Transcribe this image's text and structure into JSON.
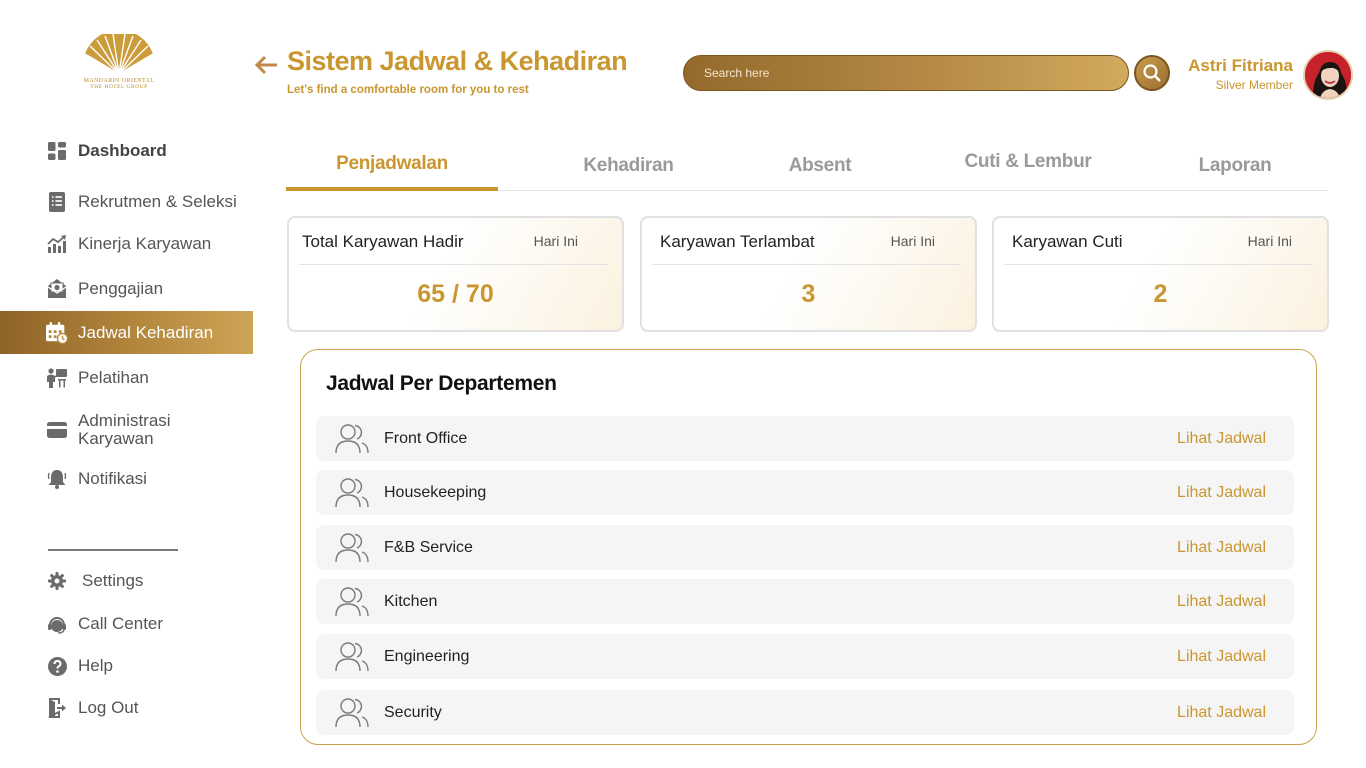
{
  "brand": {
    "name": "MANDARIN ORIENTAL",
    "tagline": "THE HOTEL GROUP",
    "accent": "#c9962f"
  },
  "sidebar": {
    "items": [
      {
        "label": "Dashboard",
        "icon": "dashboard-grid-icon"
      },
      {
        "label": "Rekrutmen & Seleksi",
        "icon": "document-list-icon"
      },
      {
        "label": "Kinerja Karyawan",
        "icon": "chart-trend-icon"
      },
      {
        "label": "Penggajian",
        "icon": "payroll-icon"
      },
      {
        "label": "Jadwal Kehadiran",
        "icon": "calendar-clock-icon",
        "active": true
      },
      {
        "label": "Pelatihan",
        "icon": "training-icon"
      },
      {
        "label": "Administrasi Karyawan",
        "icon": "card-icon"
      },
      {
        "label": "Notifikasi",
        "icon": "bell-icon"
      }
    ],
    "bottom_items": [
      {
        "label": "Settings",
        "icon": "gear-icon"
      },
      {
        "label": "Call Center",
        "icon": "headset-icon"
      },
      {
        "label": "Help",
        "icon": "help-icon"
      },
      {
        "label": "Log Out",
        "icon": "logout-icon"
      }
    ]
  },
  "header": {
    "title": "Sistem Jadwal & Kehadiran",
    "subtitle": "Let's find a comfortable room for you to rest",
    "search_placeholder": "Search here",
    "user_name": "Astri Fitriana",
    "user_role": "Silver Member"
  },
  "tabs": [
    {
      "label": "Penjadwalan",
      "active": true
    },
    {
      "label": "Kehadiran"
    },
    {
      "label": "Absent"
    },
    {
      "label": "Cuti & Lembur"
    },
    {
      "label": "Laporan"
    }
  ],
  "stats": [
    {
      "title": "Total Karyawan Hadir",
      "period": "Hari Ini",
      "value": "65 / 70"
    },
    {
      "title": "Karyawan Terlambat",
      "period": "Hari Ini",
      "value": "3"
    },
    {
      "title": "Karyawan Cuti",
      "period": "Hari Ini",
      "value": "2"
    }
  ],
  "departments": {
    "title": "Jadwal Per Departemen",
    "link_label": "Lihat Jadwal",
    "rows": [
      {
        "name": "Front Office"
      },
      {
        "name": "Housekeeping"
      },
      {
        "name": "F&B Service"
      },
      {
        "name": "Kitchen"
      },
      {
        "name": "Engineering"
      },
      {
        "name": "Security"
      }
    ]
  }
}
